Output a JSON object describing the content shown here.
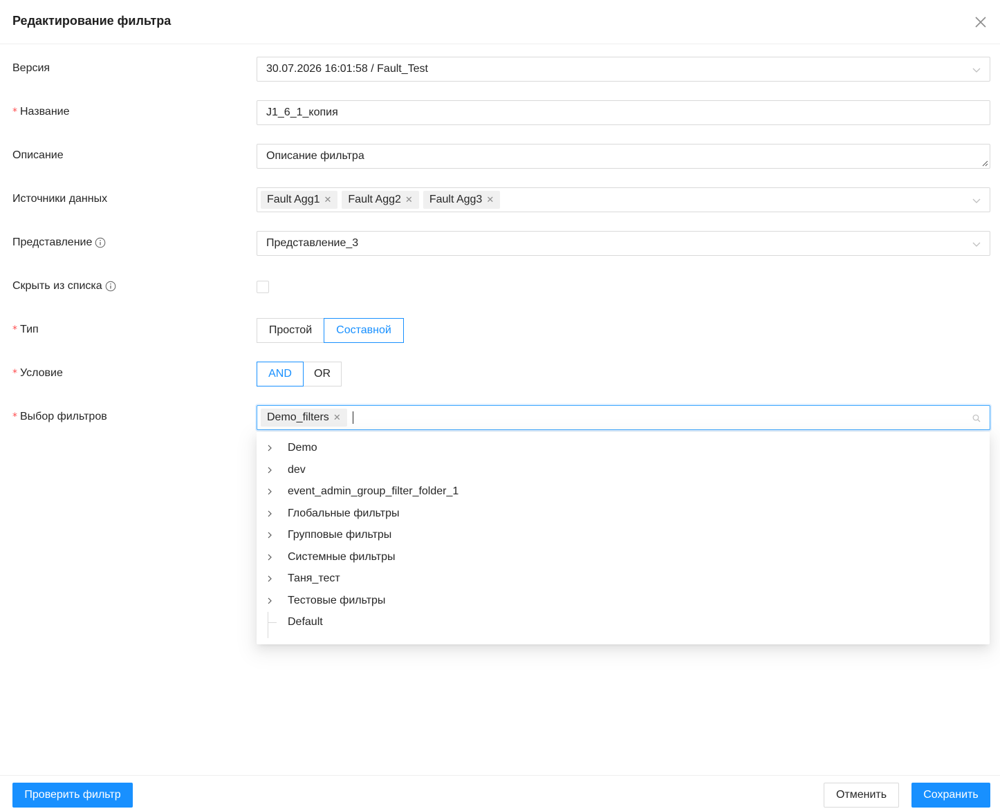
{
  "dialog": {
    "title": "Редактирование фильтра"
  },
  "form": {
    "version": {
      "label": "Версия",
      "value": "30.07.2026 16:01:58 / Fault_Test"
    },
    "name": {
      "label": "Название",
      "value": "J1_6_1_копия"
    },
    "description": {
      "label": "Описание",
      "value": "Описание фильтра"
    },
    "data_sources": {
      "label": "Источники данных",
      "tags": [
        "Fault Agg1",
        "Fault Agg2",
        "Fault Agg3"
      ]
    },
    "view": {
      "label": "Представление",
      "value": "Представление_3"
    },
    "hide_from_list": {
      "label": "Скрыть из списка",
      "checked": false
    },
    "type": {
      "label": "Тип",
      "options": [
        "Простой",
        "Составной"
      ],
      "selected": "Составной"
    },
    "condition": {
      "label": "Условие",
      "options": [
        "AND",
        "OR"
      ],
      "selected": "AND"
    },
    "filter_select": {
      "label": "Выбор фильтров",
      "tags": [
        "Demo_filters"
      ]
    },
    "required_mark": "*"
  },
  "tree": {
    "items": [
      "Demo",
      "dev",
      "event_admin_group_filter_folder_1",
      "Глобальные фильтры",
      "Групповые фильтры",
      "Системные фильтры",
      "Таня_тест",
      "Тестовые фильтры"
    ],
    "leaf": "Default"
  },
  "footer": {
    "check_label": "Проверить фильтр",
    "cancel_label": "Отменить",
    "save_label": "Сохранить"
  },
  "colors": {
    "primary": "#1890ff",
    "required": "#ff4d4f",
    "border": "#d9d9d9"
  },
  "icons": {
    "close": "close-icon",
    "chevron": "chevron-down-icon",
    "info": "info-icon",
    "search": "search-icon",
    "expand": "chevron-right-icon"
  }
}
